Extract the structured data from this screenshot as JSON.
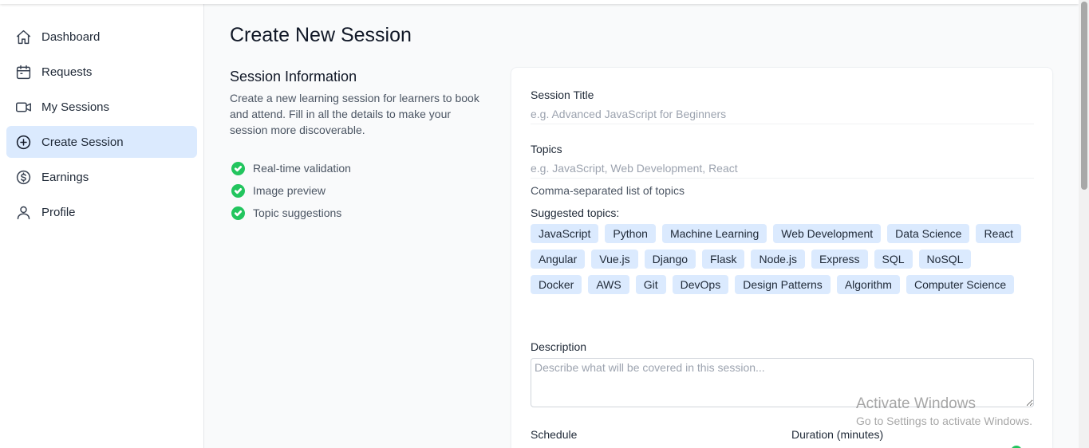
{
  "sidebar": {
    "items": [
      {
        "label": "Dashboard",
        "icon": "home-icon"
      },
      {
        "label": "Requests",
        "icon": "calendar-icon"
      },
      {
        "label": "My Sessions",
        "icon": "video-icon"
      },
      {
        "label": "Create Session",
        "icon": "plus-circle-icon",
        "active": true
      },
      {
        "label": "Earnings",
        "icon": "dollar-circle-icon"
      },
      {
        "label": "Profile",
        "icon": "user-icon"
      }
    ]
  },
  "page": {
    "title": "Create New Session"
  },
  "info": {
    "heading": "Session Information",
    "description": "Create a new learning session for learners to book and attend. Fill in all the details to make your session more discoverable.",
    "features": [
      "Real-time validation",
      "Image preview",
      "Topic suggestions"
    ]
  },
  "form": {
    "title_label": "Session Title",
    "title_placeholder": "e.g. Advanced JavaScript for Beginners",
    "title_value": "",
    "topics_label": "Topics",
    "topics_placeholder": "e.g. JavaScript, Web Development, React",
    "topics_value": "",
    "topics_helper": "Comma-separated list of topics",
    "suggested_label": "Suggested topics:",
    "suggested_topics": [
      "JavaScript",
      "Python",
      "Machine Learning",
      "Web Development",
      "Data Science",
      "React",
      "Angular",
      "Vue.js",
      "Django",
      "Flask",
      "Node.js",
      "Express",
      "SQL",
      "NoSQL",
      "Docker",
      "AWS",
      "Git",
      "DevOps",
      "Design Patterns",
      "Algorithm",
      "Computer Science"
    ],
    "description_label": "Description",
    "description_placeholder": "Describe what will be covered in this session...",
    "description_value": "",
    "schedule_label": "Schedule",
    "duration_label": "Duration (minutes)"
  },
  "watermark": {
    "line1": "Activate Windows",
    "line2": "Go to Settings to activate Windows."
  },
  "colors": {
    "accent_bg": "#dbeafe",
    "success": "#22c55e",
    "text": "#111827"
  }
}
